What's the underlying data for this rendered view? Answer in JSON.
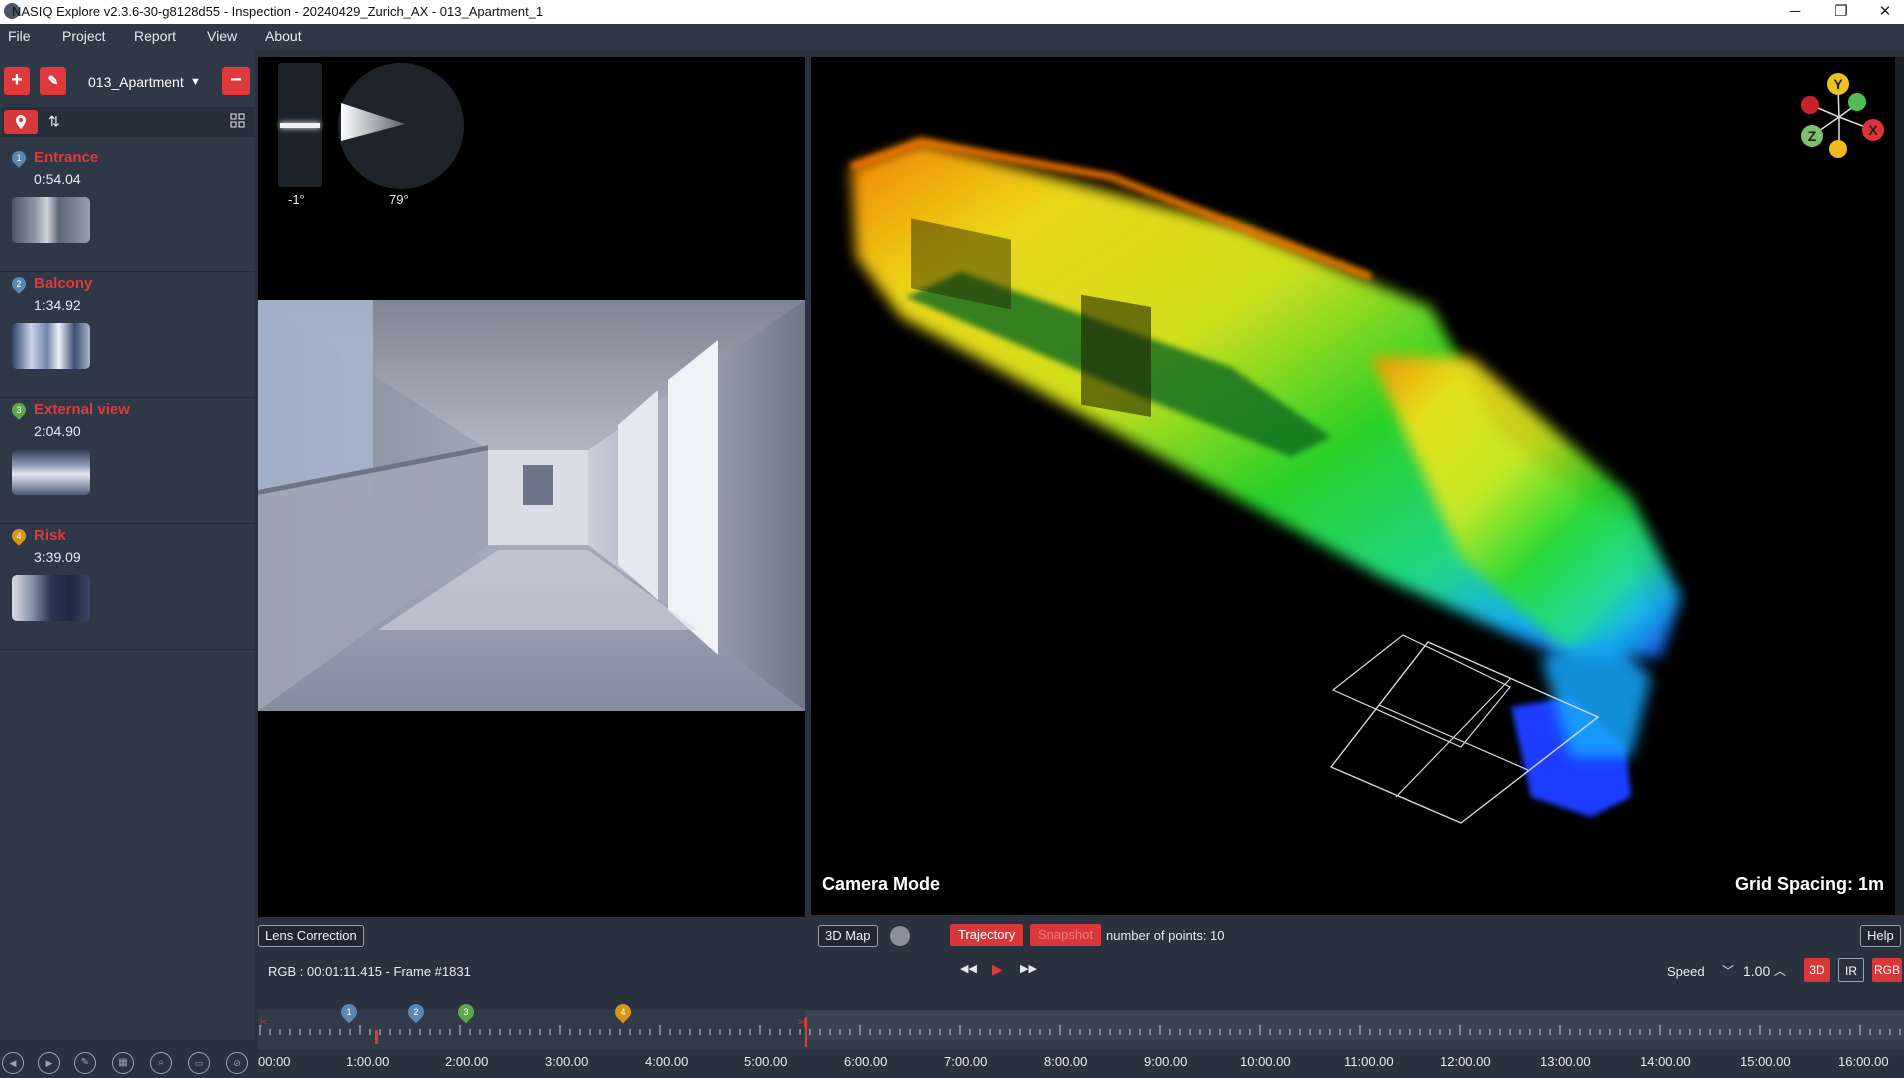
{
  "titlebar": {
    "title": "NASIQ Explore v2.3.6-30-g8128d55 - Inspection - 20240429_Zurich_AX - 013_Apartment_1",
    "minimize": "─",
    "maximize": "❐",
    "close": "✕"
  },
  "menu": [
    "File",
    "Project",
    "Report",
    "View",
    "About"
  ],
  "sidebar": {
    "project": "013_Apartment",
    "markers": [
      {
        "num": "1",
        "name": "Entrance",
        "time": "0:54.04",
        "color": "#5b87b3"
      },
      {
        "num": "2",
        "name": "Balcony",
        "time": "1:34.92",
        "color": "#5b87b3"
      },
      {
        "num": "3",
        "name": "External view",
        "time": "2:04.90",
        "color": "#5fa84a"
      },
      {
        "num": "4",
        "name": "Risk",
        "time": "3:39.09",
        "color": "#d8941c"
      }
    ]
  },
  "camera": {
    "tilt_label": "-1°",
    "heading_label": "79°",
    "lens_correction": "Lens Correction",
    "frame_info": "RGB : 00:01:11.415 - Frame #1831"
  },
  "map": {
    "mode_label": "Camera Mode",
    "grid_label": "Grid Spacing: 1m",
    "map_button": "3D Map",
    "trajectory": "Trajectory",
    "snapshot": "Snapshot",
    "points": "number of points: 10",
    "help": "Help",
    "axes": {
      "y": "Y",
      "x": "X",
      "z": "Z"
    }
  },
  "playback": {
    "rewind": "◀◀",
    "play": "▶",
    "forward": "▶▶",
    "speed_label": "Speed",
    "speed_value": "1.00",
    "mode_3d": "3D",
    "mode_ir": "IR",
    "mode_rgb": "RGB"
  },
  "timeline": {
    "labels": [
      "00:00",
      "1:00.00",
      "2:00.00",
      "3:00.00",
      "4:00.00",
      "5:00.00",
      "6:00.00",
      "7:00.00",
      "8:00.00",
      "9:00.00",
      "10:00.00",
      "11:00.00",
      "12:00.00",
      "13:00.00",
      "14:00.00",
      "15:00.00",
      "16:00.00"
    ]
  },
  "colors": {
    "accent_red": "#d9383a",
    "background": "#2a3240",
    "panel": "#2f3846"
  }
}
